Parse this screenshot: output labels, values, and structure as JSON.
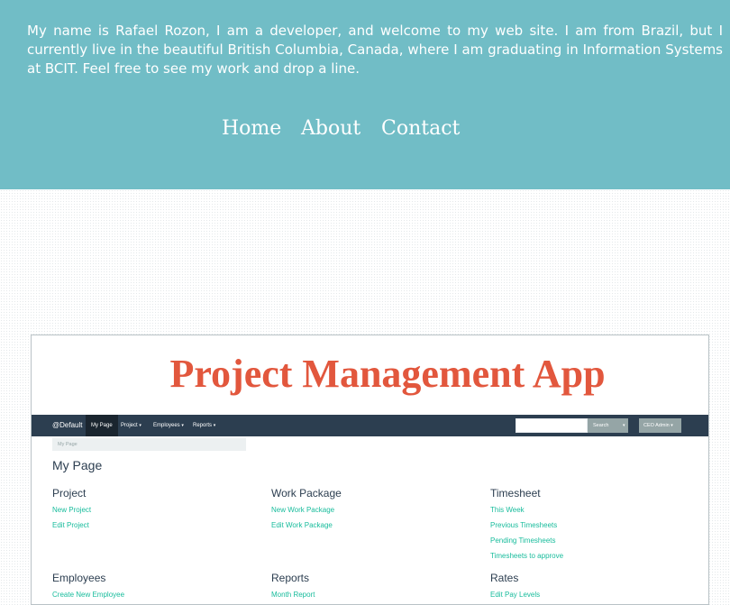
{
  "bio": "My name is Rafael Rozon, I am a developer, and welcome to my web site. I am from Brazil, but I currently live in the beautiful British Columbia, Canada, where I am graduating in Information Systems at BCIT. Feel free to see my work and drop a line.",
  "nav": {
    "home": "Home",
    "about": "About",
    "contact": "Contact"
  },
  "project": {
    "title": "Project Management App",
    "navbar": {
      "brand": "@Default",
      "my_page": "My Page",
      "project": "Project",
      "employees": "Employees",
      "reports": "Reports",
      "caret": "▾",
      "search_placeholder": "",
      "search_button": "Search",
      "admin": "CEO Admin"
    },
    "breadcrumb": "My Page",
    "page_title": "My Page",
    "sections": {
      "project": {
        "title": "Project",
        "links": [
          "New Project",
          "Edit Project"
        ]
      },
      "work_package": {
        "title": "Work Package",
        "links": [
          "New Work Package",
          "Edit Work Package"
        ]
      },
      "timesheet": {
        "title": "Timesheet",
        "links": [
          "This Week",
          "Previous Timesheets",
          "Pending Timesheets",
          "Timesheets to approve"
        ]
      },
      "employees": {
        "title": "Employees",
        "links": [
          "Create New Employee"
        ]
      },
      "reports": {
        "title": "Reports",
        "links": [
          "Month Report"
        ]
      },
      "rates": {
        "title": "Rates",
        "links": [
          "Edit Pay Levels"
        ]
      }
    }
  },
  "colors": {
    "hero": "#71bdc6",
    "title": "#e2573d",
    "navbar": "#2c3e50",
    "link": "#18bc9c"
  },
  "icons": {
    "dropdown": "caret-down-icon"
  }
}
